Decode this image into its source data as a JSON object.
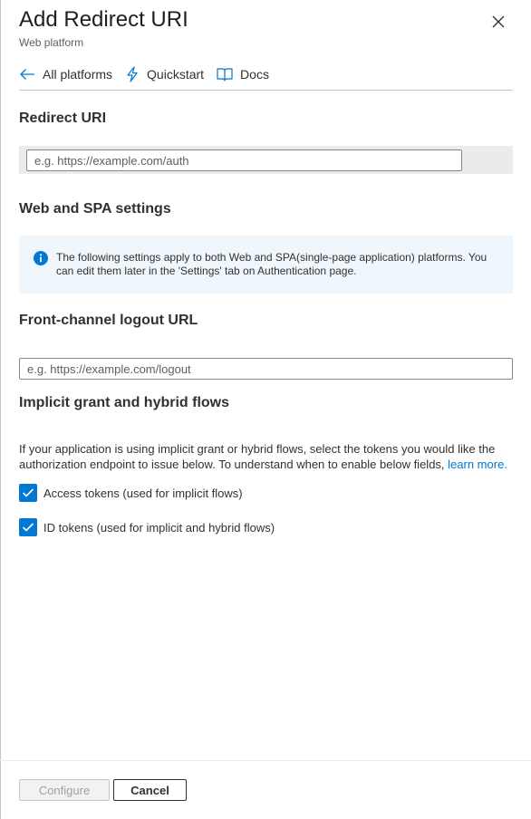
{
  "panel": {
    "title": "Add Redirect URI",
    "subtitle": "Web platform"
  },
  "nav": {
    "all_platforms": "All platforms",
    "quickstart": "Quickstart",
    "docs": "Docs"
  },
  "redirect": {
    "heading": "Redirect URI",
    "placeholder": "e.g. https://example.com/auth",
    "value": ""
  },
  "web_spa": {
    "heading": "Web and SPA settings",
    "info": "The following settings apply to both Web and SPA(single-page application) platforms. You can edit them later in the 'Settings' tab on Authentication page."
  },
  "logout": {
    "heading": "Front-channel logout URL",
    "placeholder": "e.g. https://example.com/logout",
    "value": ""
  },
  "implicit": {
    "heading": "Implicit grant and hybrid flows",
    "description": "If your application is using implicit grant or hybrid flows, select the tokens you would like the authorization endpoint to issue below. To understand when to enable below fields,",
    "learn_more": "learn more.",
    "options": [
      {
        "label": "Access tokens (used for implicit flows)",
        "checked": true
      },
      {
        "label": "ID tokens (used for implicit and hybrid flows)",
        "checked": true
      }
    ]
  },
  "footer": {
    "configure": "Configure",
    "cancel": "Cancel"
  },
  "icons": {
    "close": "close-icon",
    "back": "arrow-left-icon",
    "quickstart": "lightning-icon",
    "docs": "book-icon",
    "info": "info-icon",
    "check": "checkmark-icon"
  },
  "colors": {
    "accent": "#0078d4",
    "info_bg": "#eff6fc",
    "band_bg": "#edebe9",
    "disabled_text": "#a19f9d"
  }
}
